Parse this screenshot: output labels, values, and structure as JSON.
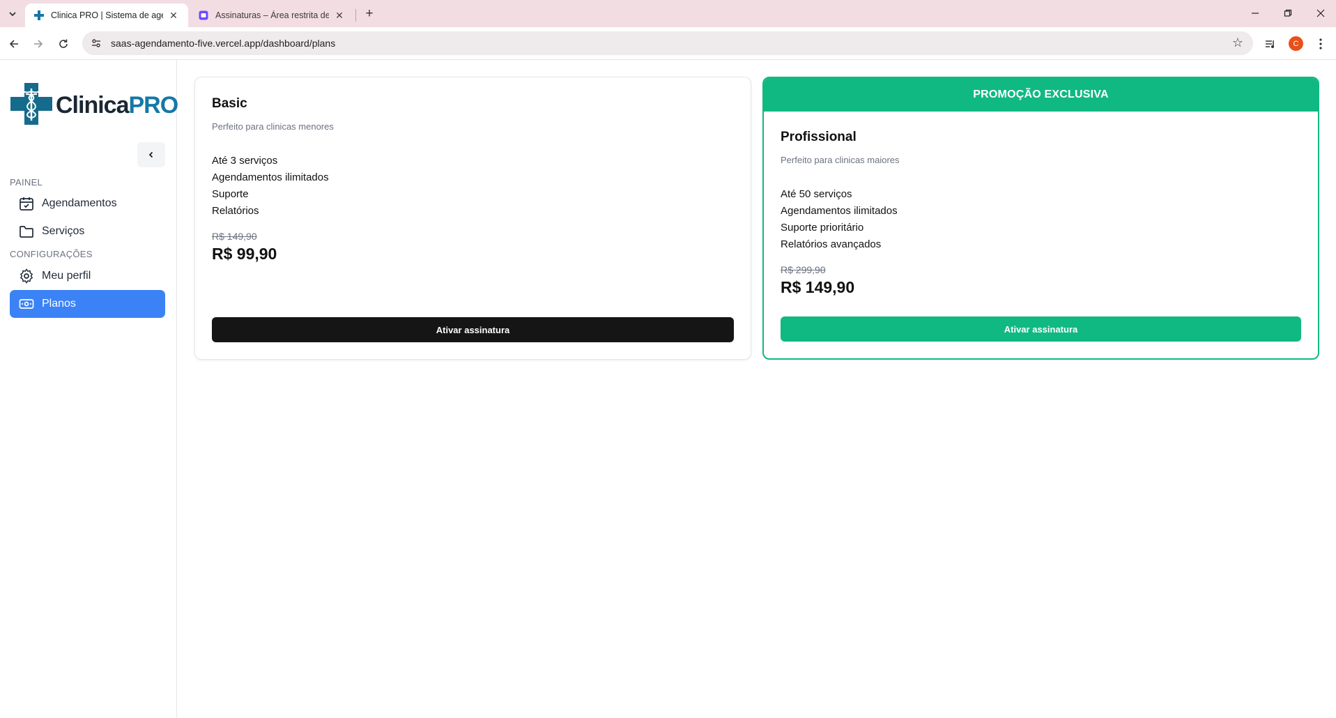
{
  "browser": {
    "tabs": [
      {
        "title": "Clinica PRO | Sistema de agend",
        "active": true
      },
      {
        "title": "Assinaturas – Área restrita de N",
        "active": false
      }
    ],
    "url": "saas-agendamento-five.vercel.app/dashboard/plans",
    "profile_initial": "C",
    "icons": {
      "tab_list": "chevron-down-icon",
      "new_tab": "plus-icon",
      "back": "arrow-left-icon",
      "forward": "arrow-right-icon",
      "reload": "reload-icon",
      "site_info": "tune-icon",
      "bookmark": "star-icon",
      "media": "media-control-icon",
      "menu": "kebab-menu-icon",
      "minimize": "minimize-icon",
      "restore": "restore-icon",
      "close": "close-icon"
    }
  },
  "logo": {
    "part1": "Clinica",
    "part2": "PRO",
    "icon": "medical-cross-caduceus-icon"
  },
  "sidebar": {
    "collapse_icon": "chevron-left-icon",
    "sections": [
      {
        "label": "PAINEL",
        "items": [
          {
            "label": "Agendamentos",
            "icon": "calendar-check-icon",
            "active": false
          },
          {
            "label": "Serviços",
            "icon": "folder-icon",
            "active": false
          }
        ]
      },
      {
        "label": "CONFIGURAÇÕES",
        "items": [
          {
            "label": "Meu perfil",
            "icon": "gear-icon",
            "active": false
          },
          {
            "label": "Planos",
            "icon": "banknote-icon",
            "active": true
          }
        ]
      }
    ]
  },
  "plans": [
    {
      "name": "Basic",
      "description": "Perfeito para clinicas menores",
      "features": [
        "Até 3 serviços",
        "Agendamentos ilimitados",
        "Suporte",
        "Relatórios"
      ],
      "old_price": "R$ 149,90",
      "price": "R$ 99,90",
      "button_label": "Ativar assinatura",
      "highlight": false
    },
    {
      "name": "Profissional",
      "description": "Perfeito para clinicas maiores",
      "features": [
        "Até 50 serviços",
        "Agendamentos ilimitados",
        "Suporte prioritário",
        "Relatórios avançados"
      ],
      "old_price": "R$ 299,90",
      "price": "R$ 149,90",
      "button_label": "Ativar assinatura",
      "highlight": true,
      "banner": "PROMOÇÃO EXCLUSIVA"
    }
  ],
  "colors": {
    "accent_blue": "#3b82f6",
    "promo_green": "#10b981",
    "logo_teal": "#1478a8",
    "tabbar_bg": "#f2dde3",
    "profile_orange": "#e8501c"
  }
}
